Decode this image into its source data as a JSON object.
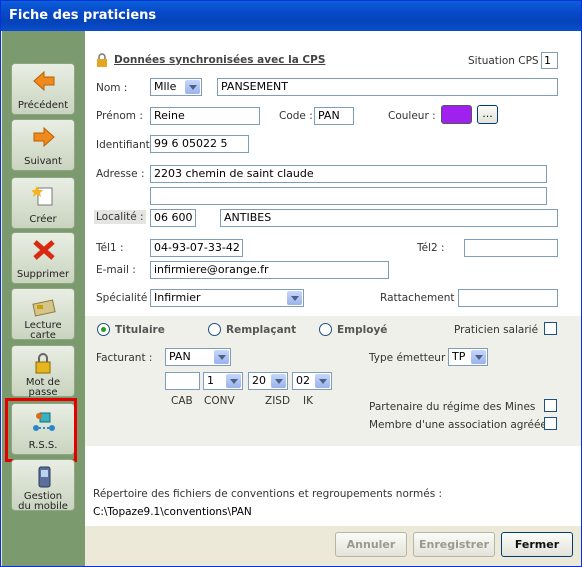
{
  "window": {
    "title": "Fiche des praticiens"
  },
  "sidebar": {
    "items": [
      {
        "label": "Précédent"
      },
      {
        "label": "Suivant"
      },
      {
        "label": "Créer"
      },
      {
        "label": "Supprimer"
      },
      {
        "label_line1": "Lecture",
        "label_line2": "carte"
      },
      {
        "label_line1": "Mot de",
        "label_line2": "passe"
      },
      {
        "label": "R.S.S."
      },
      {
        "label_line1": "Gestion",
        "label_line2": "du mobile"
      }
    ]
  },
  "form": {
    "sync_label": "Données synchronisées avec la CPS",
    "situation_label": "Situation CPS :",
    "situation_value": "1",
    "nom_label": "Nom :",
    "civilite": "Mlle",
    "nom": "PANSEMENT",
    "prenom_label": "Prénom :",
    "prenom": "Reine",
    "code_label": "Code :",
    "code": "PAN",
    "couleur_label": "Couleur :",
    "couleur_value": "#a020f0",
    "couleur_btn": "...",
    "identifiant_label": "Identifiant :",
    "identifiant": "99 6 05022 5",
    "adresse_label": "Adresse :",
    "adresse1": "2203 chemin de saint claude",
    "adresse2": "",
    "localite_label": "Localité :",
    "code_postal": "06 600",
    "ville": "ANTIBES",
    "tel1_label": "Tél1 :",
    "tel1": "04-93-07-33-42",
    "tel2_label": "Tél2 :",
    "tel2": "",
    "email_label": "E-mail :",
    "email": "infirmiere@orange.fr",
    "specialite_label": "Spécialité :",
    "specialite": "Infirmier",
    "rattachement_label": "Rattachement :",
    "rattachement": ""
  },
  "statut": {
    "titulaire": "Titulaire",
    "remplacant": "Remplaçant",
    "employe": "Employé",
    "salarie": "Praticien salarié",
    "facturant_label": "Facturant :",
    "facturant": "PAN",
    "type_emetteur_label": "Type émetteur :",
    "type_emetteur": "TP",
    "cab_value": "",
    "conv_value": "1",
    "zisd_value": "20",
    "ik_value": "02",
    "cab_label": "CAB",
    "conv_label": "CONV",
    "zisd_label": "ZISD",
    "ik_label": "IK",
    "mines_label": "Partenaire du régime des Mines",
    "association_label": "Membre d'une association agréée"
  },
  "repertoire": {
    "label": "Répertoire des fichiers de conventions et regroupements normés :",
    "path": "C:\\Topaze9.1\\conventions\\PAN"
  },
  "buttons": {
    "annuler": "Annuler",
    "enregistrer": "Enregistrer",
    "fermer": "Fermer"
  }
}
